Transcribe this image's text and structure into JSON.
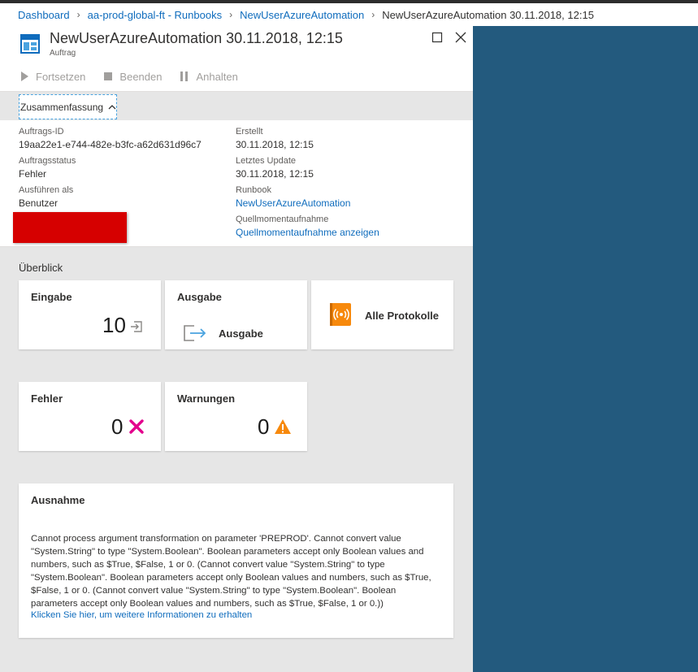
{
  "breadcrumb": {
    "items": [
      "Dashboard",
      "aa-prod-global-ft - Runbooks",
      "NewUserAzureAutomation"
    ],
    "current": "NewUserAzureAutomation 30.11.2018, 12:15"
  },
  "blade": {
    "title": "NewUserAzureAutomation 30.11.2018, 12:15",
    "subtitle": "Auftrag",
    "icon": "automation-job-icon"
  },
  "toolbar": {
    "resume_label": "Fortsetzen",
    "stop_label": "Beenden",
    "suspend_label": "Anhalten"
  },
  "summary_tab": {
    "label": "Zusammenfassung"
  },
  "essentials": {
    "job_id_label": "Auftrags-ID",
    "job_id_value": "19aa22e1-e744-482e-b3fc-a62d631d96c7",
    "status_label": "Auftragsstatus",
    "status_value": "Fehler",
    "run_as_label": "Ausführen als",
    "run_as_value": "Benutzer",
    "created_label": "Erstellt",
    "created_value": "30.11.2018, 12:15",
    "updated_label": "Letztes Update",
    "updated_value": "30.11.2018, 12:15",
    "runbook_label": "Runbook",
    "runbook_value": "NewUserAzureAutomation",
    "snapshot_label": "Quellmomentaufnahme",
    "snapshot_value": "Quellmomentaufnahme anzeigen"
  },
  "overview": {
    "title": "Überblick",
    "tiles": {
      "input": {
        "title": "Eingabe",
        "count": "10"
      },
      "output": {
        "title": "Ausgabe",
        "label": "Ausgabe"
      },
      "logs": {
        "title": "Alle Protokolle"
      },
      "errors": {
        "title": "Fehler",
        "count": "0"
      },
      "warnings": {
        "title": "Warnungen",
        "count": "0"
      }
    }
  },
  "exception": {
    "title": "Ausnahme",
    "text": "Cannot process argument transformation on parameter 'PREPROD'. Cannot convert value \"System.String\" to type \"System.Boolean\". Boolean parameters accept only Boolean values and numbers, such as $True, $False, 1 or 0. (Cannot convert value \"System.String\" to type \"System.Boolean\". Boolean parameters accept only Boolean values and numbers, such as $True, $False, 1 or 0. (Cannot convert value \"System.String\" to type \"System.Boolean\". Boolean parameters accept only Boolean values and numbers, such as $True, $False, 1 or 0.))",
    "link": "Klicken Sie hier, um weitere Informationen zu erhalten"
  },
  "colors": {
    "link": "#0f6cbd",
    "right_panel": "#235a7e",
    "error_x": "#e3008c",
    "warning": "#f7890c",
    "logs_icon": "#f7890c",
    "redaction": "#d60000"
  }
}
